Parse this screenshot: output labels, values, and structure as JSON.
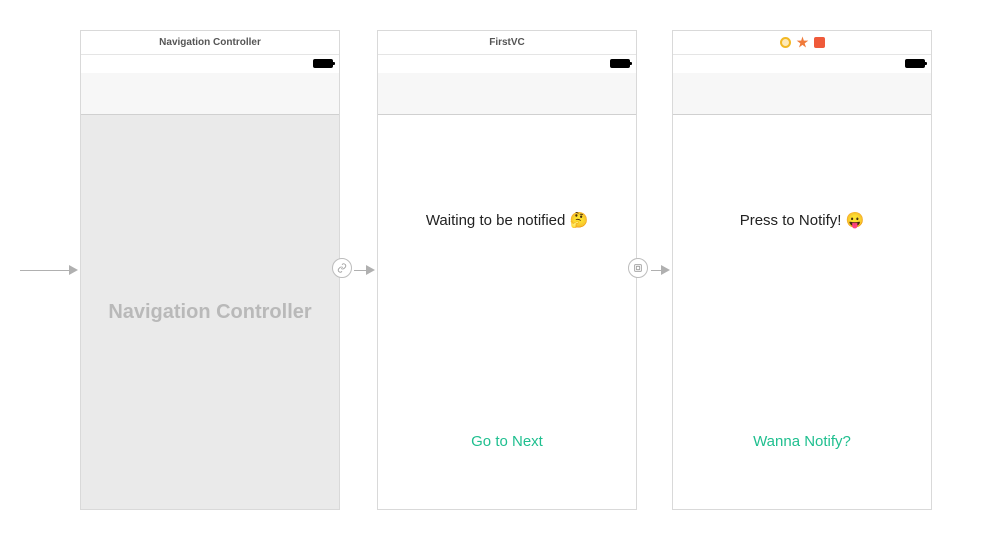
{
  "scenes": {
    "nav": {
      "title": "Navigation Controller",
      "body_label": "Navigation Controller"
    },
    "first": {
      "title": "FirstVC",
      "heading": "Waiting to be notified 🤔",
      "button": "Go to Next"
    },
    "second": {
      "title": "",
      "heading": "Press to Notify! 😛",
      "button": "Wanna Notify?"
    }
  },
  "segues": {
    "root_relationship": "link-icon",
    "show": "present-icon"
  },
  "colors": {
    "tint": "#1fbf8f",
    "placeholder_gray": "#b9b9b9"
  }
}
